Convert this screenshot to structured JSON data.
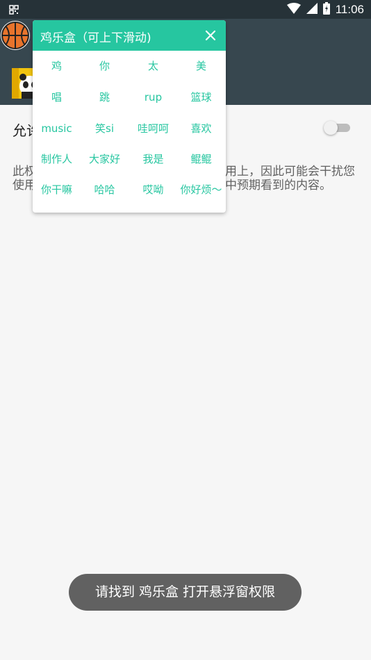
{
  "status_bar": {
    "time": "11:06",
    "icons": [
      "notification-icon",
      "wifi-icon",
      "signal-icon",
      "battery-icon"
    ]
  },
  "settings": {
    "permission_title": "允许",
    "description": "此权限允许此应用显示在您使用的其他应用上，因此可能会干扰您使用其他应用的界面或改变您在其他应用中预期看到的内容。"
  },
  "panel": {
    "title": "鸡乐盒（可上下滑动)",
    "accent": "#26c6a0",
    "items": [
      [
        "鸡",
        "你",
        "太",
        "美"
      ],
      [
        "唱",
        "跳",
        "rup",
        "篮球"
      ],
      [
        "music",
        "笑si",
        "哇呵呵",
        "喜欢"
      ],
      [
        "制作人",
        "大家好",
        "我是",
        "鲲鲲"
      ],
      [
        "你干嘛",
        "哈哈",
        "哎呦",
        "你好烦～"
      ]
    ]
  },
  "toast": {
    "text": "请找到 鸡乐盒 打开悬浮窗权限"
  },
  "colors": {
    "statusbar": "#263238",
    "toolbar": "#37474f",
    "background": "#f6f6f6"
  }
}
